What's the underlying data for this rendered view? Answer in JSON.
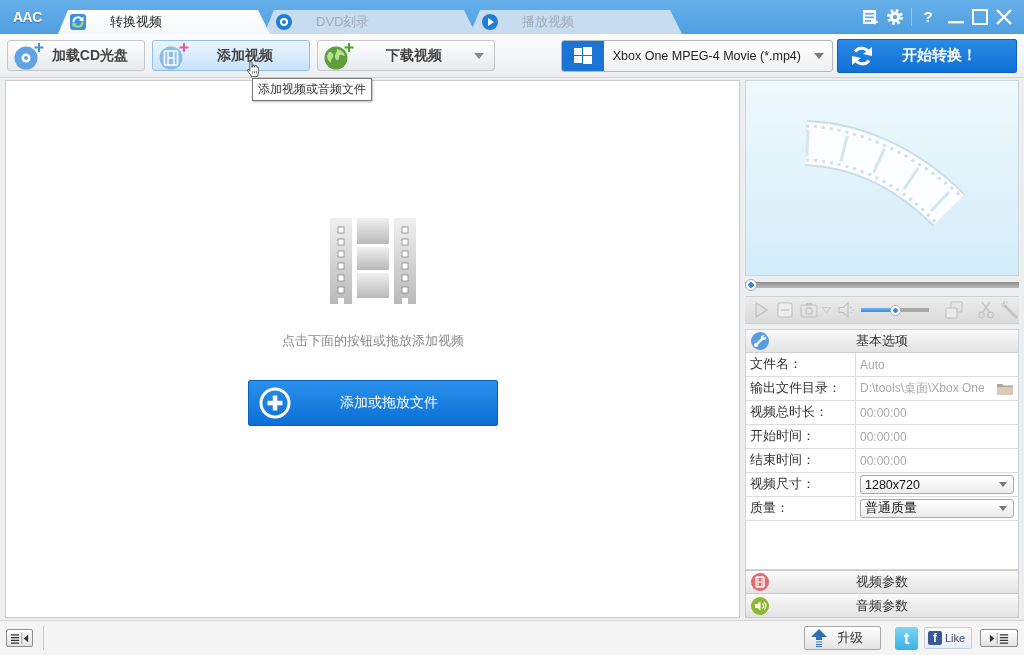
{
  "title_bar": {
    "logo": "AAC",
    "tabs": [
      {
        "label": "转换视频",
        "kind": "convert",
        "selected": true
      },
      {
        "label": "DVD刻录",
        "kind": "disc",
        "selected": false
      },
      {
        "label": "播放视频",
        "kind": "play",
        "selected": false
      }
    ],
    "help": "?"
  },
  "toolbar": {
    "buttons": [
      {
        "label": "加载CD光盘",
        "kind": "disc",
        "hovered": false,
        "dropdown": false
      },
      {
        "label": "添加视频",
        "kind": "film",
        "hovered": true,
        "dropdown": false
      },
      {
        "label": "下载视频",
        "kind": "globe",
        "hovered": false,
        "dropdown": true
      }
    ],
    "format": {
      "value": "Xbox One MPEG-4 Movie (*.mp4)"
    },
    "start_button": {
      "label": "开始转换！"
    }
  },
  "tooltip": {
    "text": "添加视频或音频文件"
  },
  "drop_area": {
    "hint": "点击下面的按钮或拖放添加视频",
    "button": {
      "label": "添加或拖放文件"
    }
  },
  "player": {
    "seek": {
      "level": 0
    },
    "volume": {
      "level": 0.5
    }
  },
  "options": {
    "title": "基本选项",
    "rows": [
      {
        "label": "文件名：",
        "value": "Auto",
        "kind": "text",
        "disabled": true
      },
      {
        "label": "输出文件目录：",
        "value": "D:\\tools\\桌面\\Xbox One",
        "kind": "folder",
        "disabled": true
      },
      {
        "label": "视频总时长：",
        "value": "00:00:00",
        "kind": "text",
        "disabled": true
      },
      {
        "label": "开始时间：",
        "value": "00:00:00",
        "kind": "text",
        "disabled": true
      },
      {
        "label": "结束时间：",
        "value": "00:00:00",
        "kind": "text",
        "disabled": true
      },
      {
        "label": "视频尺寸：",
        "value": "1280x720",
        "kind": "select",
        "disabled": false
      },
      {
        "label": "质量：",
        "value": "普通质量",
        "kind": "select",
        "disabled": false
      }
    ]
  },
  "sections": [
    {
      "title": "视频参数",
      "kind": "video"
    },
    {
      "title": "音频参数",
      "kind": "audio"
    }
  ],
  "status_bar": {
    "upgrade": {
      "label": "升级"
    },
    "share": {
      "letter": "t"
    },
    "like": {
      "letter": "f",
      "label": "Like"
    }
  }
}
